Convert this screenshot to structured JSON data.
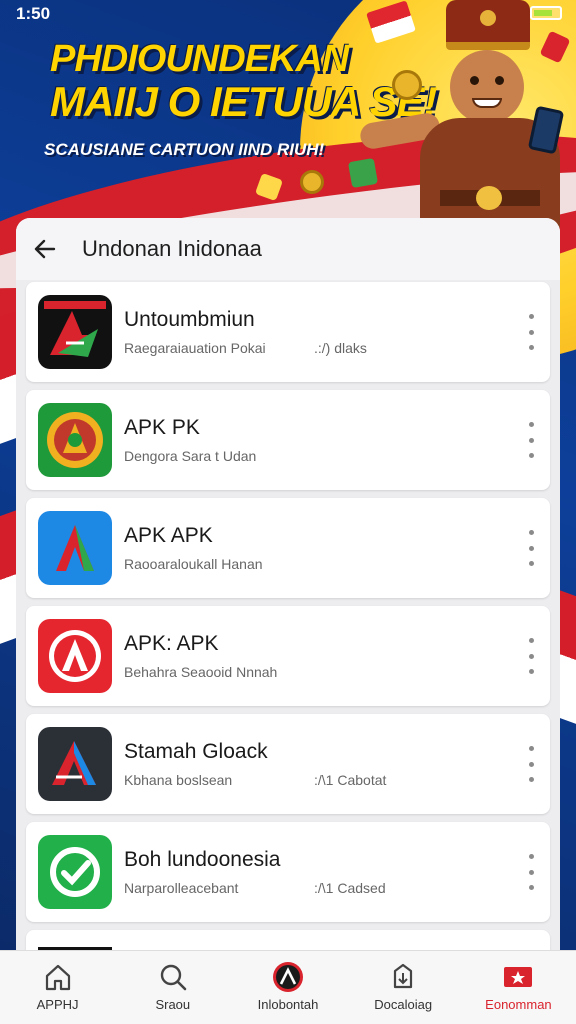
{
  "status_bar": {
    "time": "1:50"
  },
  "banner": {
    "headline_line1": "PHDIOUNDEKAN",
    "headline_line2": "MAIIJ O IETUUA SE!",
    "subline": "SCAUSIANE CARTUON IIND RIUH!"
  },
  "sheet": {
    "title": "Undonan Inidonaa",
    "apps": [
      {
        "title": "Untoumbmiun",
        "subtitle": "Raegaraiauation Pokai",
        "extra": ".:/) dlaks",
        "icon": "red-green-a-logo-icon"
      },
      {
        "title": "APK PK",
        "subtitle": "Dengora Sara t Udan",
        "extra": "",
        "icon": "green-gold-badge-icon"
      },
      {
        "title": "APK APK",
        "subtitle": "Raooaraloukall Hanan",
        "extra": "",
        "icon": "blue-a-logo-icon"
      },
      {
        "title": "APK: APK",
        "subtitle": "Behahra Seaooid Nnnah",
        "extra": "",
        "icon": "red-a-badge-icon"
      },
      {
        "title": "Stamah Gloack",
        "subtitle": "Kbhana boslsean",
        "extra": ":/\\1 Cabotat",
        "icon": "dark-a-logo-icon"
      },
      {
        "title": "Boh lundoonesia",
        "subtitle": "Narparolleacebant",
        "extra": ":/\\1 Cadsed",
        "icon": "green-shield-icon"
      }
    ],
    "partial_item": {
      "title": ""
    }
  },
  "bottom_nav": [
    {
      "label": "APPHJ",
      "icon": "home-icon"
    },
    {
      "label": "Sraou",
      "icon": "search-icon"
    },
    {
      "label": "Inlobontah",
      "icon": "app-logo-icon"
    },
    {
      "label": "Docaloiag",
      "icon": "download-box-icon"
    },
    {
      "label": "Eonomman",
      "icon": "flag-icon"
    }
  ],
  "colors": {
    "accent_red": "#d9232d",
    "banner_yellow": "#ffd400",
    "banner_blue": "#0d3f9a"
  }
}
